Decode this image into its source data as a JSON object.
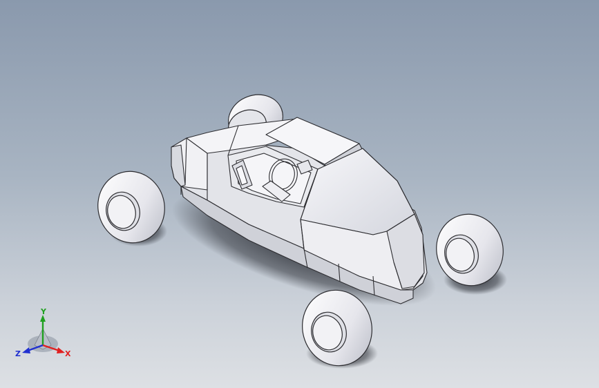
{
  "viewport": {
    "background_top": "#8a99ad",
    "background_bottom": "#dde0e4"
  },
  "model": {
    "body_color": "#ececf0",
    "edge_color": "#2c2c30",
    "wheel_color": "#f4f4f7",
    "shadow_color": "#353840"
  },
  "triad": {
    "x_label": "X",
    "y_label": "Y",
    "z_label": "Z",
    "x_color": "#e02020",
    "y_color": "#1fa01f",
    "z_color": "#2030d0"
  }
}
